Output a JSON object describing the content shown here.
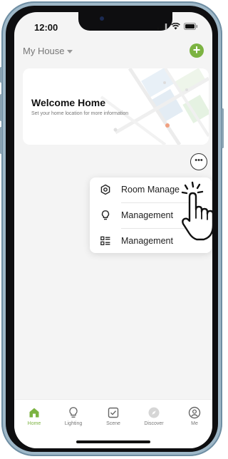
{
  "status": {
    "time": "12:00"
  },
  "header": {
    "house_name": "My House"
  },
  "welcome": {
    "title": "Welcome Home",
    "subtitle": "Set your home location for more information"
  },
  "more_menu": {
    "items": [
      {
        "label": "Room Manage",
        "icon": "hexagon-settings-icon"
      },
      {
        "label": "Management",
        "icon": "lightbulb-icon"
      },
      {
        "label": "Management",
        "icon": "list-icon"
      }
    ]
  },
  "tabs": [
    {
      "label": "Home",
      "icon": "home-icon",
      "active": true
    },
    {
      "label": "Lighting",
      "icon": "lightbulb-icon"
    },
    {
      "label": "Scene",
      "icon": "scene-check-icon"
    },
    {
      "label": "Discover",
      "icon": "compass-icon"
    },
    {
      "label": "Me",
      "icon": "user-icon"
    }
  ],
  "colors": {
    "accent": "#7cb342",
    "background": "#f4f4f4",
    "frame": "#9fb8c8"
  }
}
